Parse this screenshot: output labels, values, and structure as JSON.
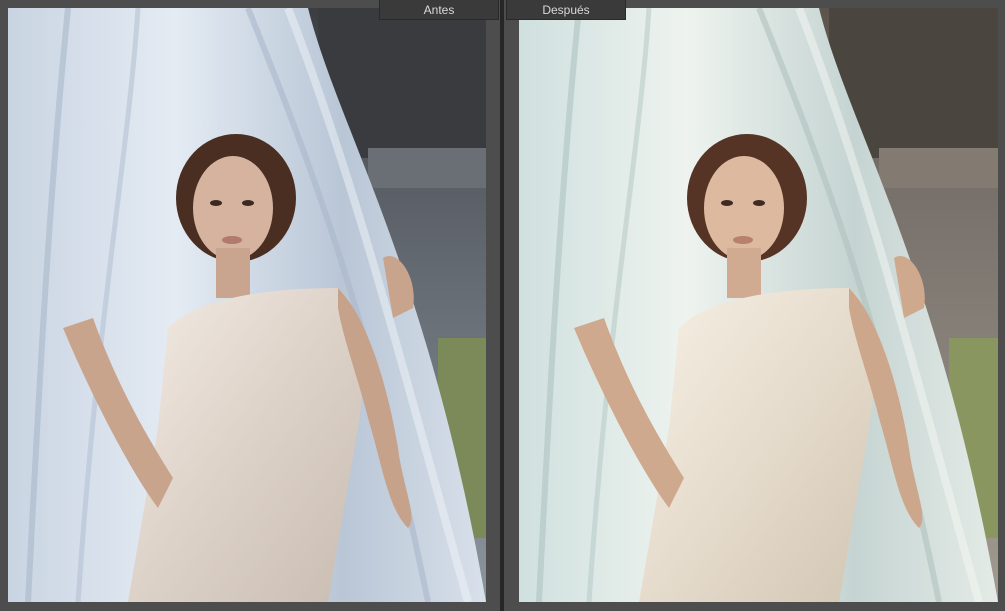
{
  "compare": {
    "before_label": "Antes",
    "after_label": "Después"
  },
  "colors": {
    "background": "#4b4b4b",
    "divider": "#262626",
    "label_bg": "#3a3a3a",
    "label_text": "#d8d8d8"
  },
  "photos": {
    "before": {
      "tone": "cool-blue"
    },
    "after": {
      "tone": "warm-teal"
    }
  }
}
